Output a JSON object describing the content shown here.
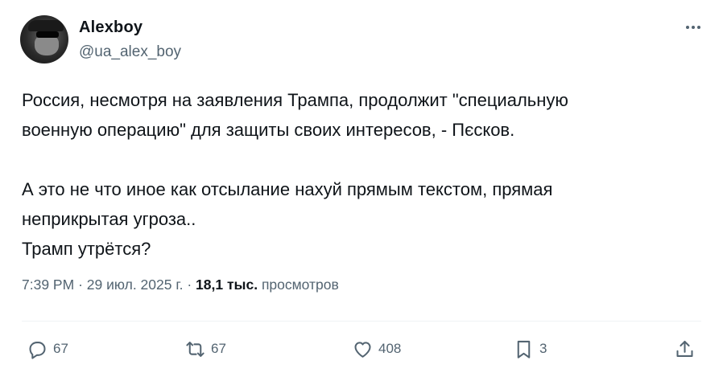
{
  "author": {
    "display_name": "Alexboy",
    "handle": "@ua_alex_boy"
  },
  "tweet": {
    "text": "Россия, несмотря на заявления Трампа, продолжит \"специальную\nвоенную операцию\" для защиты своих интересов, - Пєсков.\n\nА это не что иное как отсылание нахуй прямым текстом, прямая\nнеприкрытая угроза..\nТрамп утрётся?"
  },
  "meta": {
    "time": "7:39 PM",
    "separator": "·",
    "date": "29 июл. 2025 г.",
    "views_count": "18,1 тыс.",
    "views_label": "просмотров"
  },
  "actions": {
    "reply_count": "67",
    "repost_count": "67",
    "like_count": "408",
    "bookmark_count": "3"
  },
  "icons": {
    "more": "more-horizontal-icon",
    "reply": "reply-icon",
    "repost": "repost-icon",
    "like": "heart-icon",
    "bookmark": "bookmark-icon",
    "share": "share-icon"
  }
}
